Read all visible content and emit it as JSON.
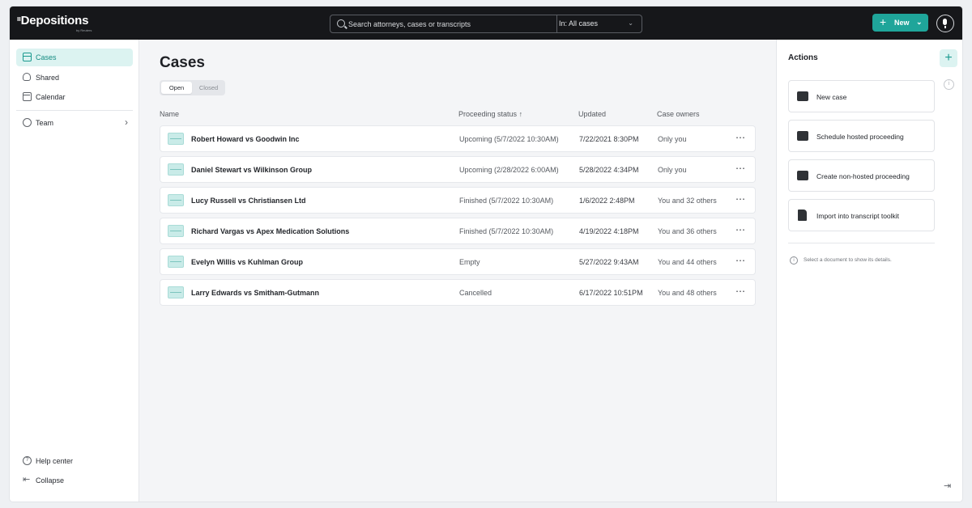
{
  "app": {
    "logo": "Depositions",
    "logo_sub": "by Reuters"
  },
  "header": {
    "search_placeholder": "Search attorneys, cases or transcripts",
    "scope_label": "In: All cases",
    "new_label": "New",
    "accent": "#1fa59a"
  },
  "sidebar": {
    "items": [
      {
        "label": "Cases",
        "icon": "cases-icon",
        "active": true
      },
      {
        "label": "Shared",
        "icon": "user-icon"
      },
      {
        "label": "Calendar",
        "icon": "calendar-icon"
      },
      {
        "label": "Team",
        "icon": "team-icon"
      }
    ],
    "footer": {
      "help": "Help center",
      "collapse": "Collapse"
    }
  },
  "main": {
    "title": "Cases",
    "tabs": [
      {
        "label": "Open",
        "selected": true
      },
      {
        "label": "Closed",
        "selected": false
      }
    ],
    "columns": [
      "Name",
      "Proceeding status",
      "Updated",
      "Case owners"
    ],
    "rows": [
      {
        "name": "Robert Howard vs Goodwin Inc",
        "status": "Upcoming (5/7/2022 10:30AM)",
        "updated": "7/22/2021 8:30PM",
        "owners": "Only you"
      },
      {
        "name": "Daniel Stewart vs Wilkinson Group",
        "status": "Upcoming (2/28/2022 6:00AM)",
        "updated": "5/28/2022 4:34PM",
        "owners": "Only you"
      },
      {
        "name": "Lucy Russell vs Christiansen Ltd",
        "status": "Finished (5/7/2022 10:30AM)",
        "updated": "1/6/2022 2:48PM",
        "owners": "You and 32 others"
      },
      {
        "name": "Richard Vargas vs Apex Medication Solutions",
        "status": "Finished (5/7/2022 10:30AM)",
        "updated": "4/19/2022 4:18PM",
        "owners": "You and 36 others"
      },
      {
        "name": "Evelyn Willis vs Kuhlman Group",
        "status": "Empty",
        "updated": "5/27/2022 9:43AM",
        "owners": "You and 44 others"
      },
      {
        "name": "Larry Edwards vs Smitham-Gutmann",
        "status": "Cancelled",
        "updated": "6/17/2022 10:51PM",
        "owners": "You and 48 others"
      }
    ]
  },
  "actions": {
    "title": "Actions",
    "items": [
      {
        "label": "New case",
        "icon": "case-icon"
      },
      {
        "label": "Schedule hosted proceeding",
        "icon": "folder-download-icon"
      },
      {
        "label": "Create non-hosted proceeding",
        "icon": "folder-download-icon"
      },
      {
        "label": "Import into transcript toolkit",
        "icon": "document-icon"
      }
    ],
    "hint": "Select a document to show its details."
  }
}
